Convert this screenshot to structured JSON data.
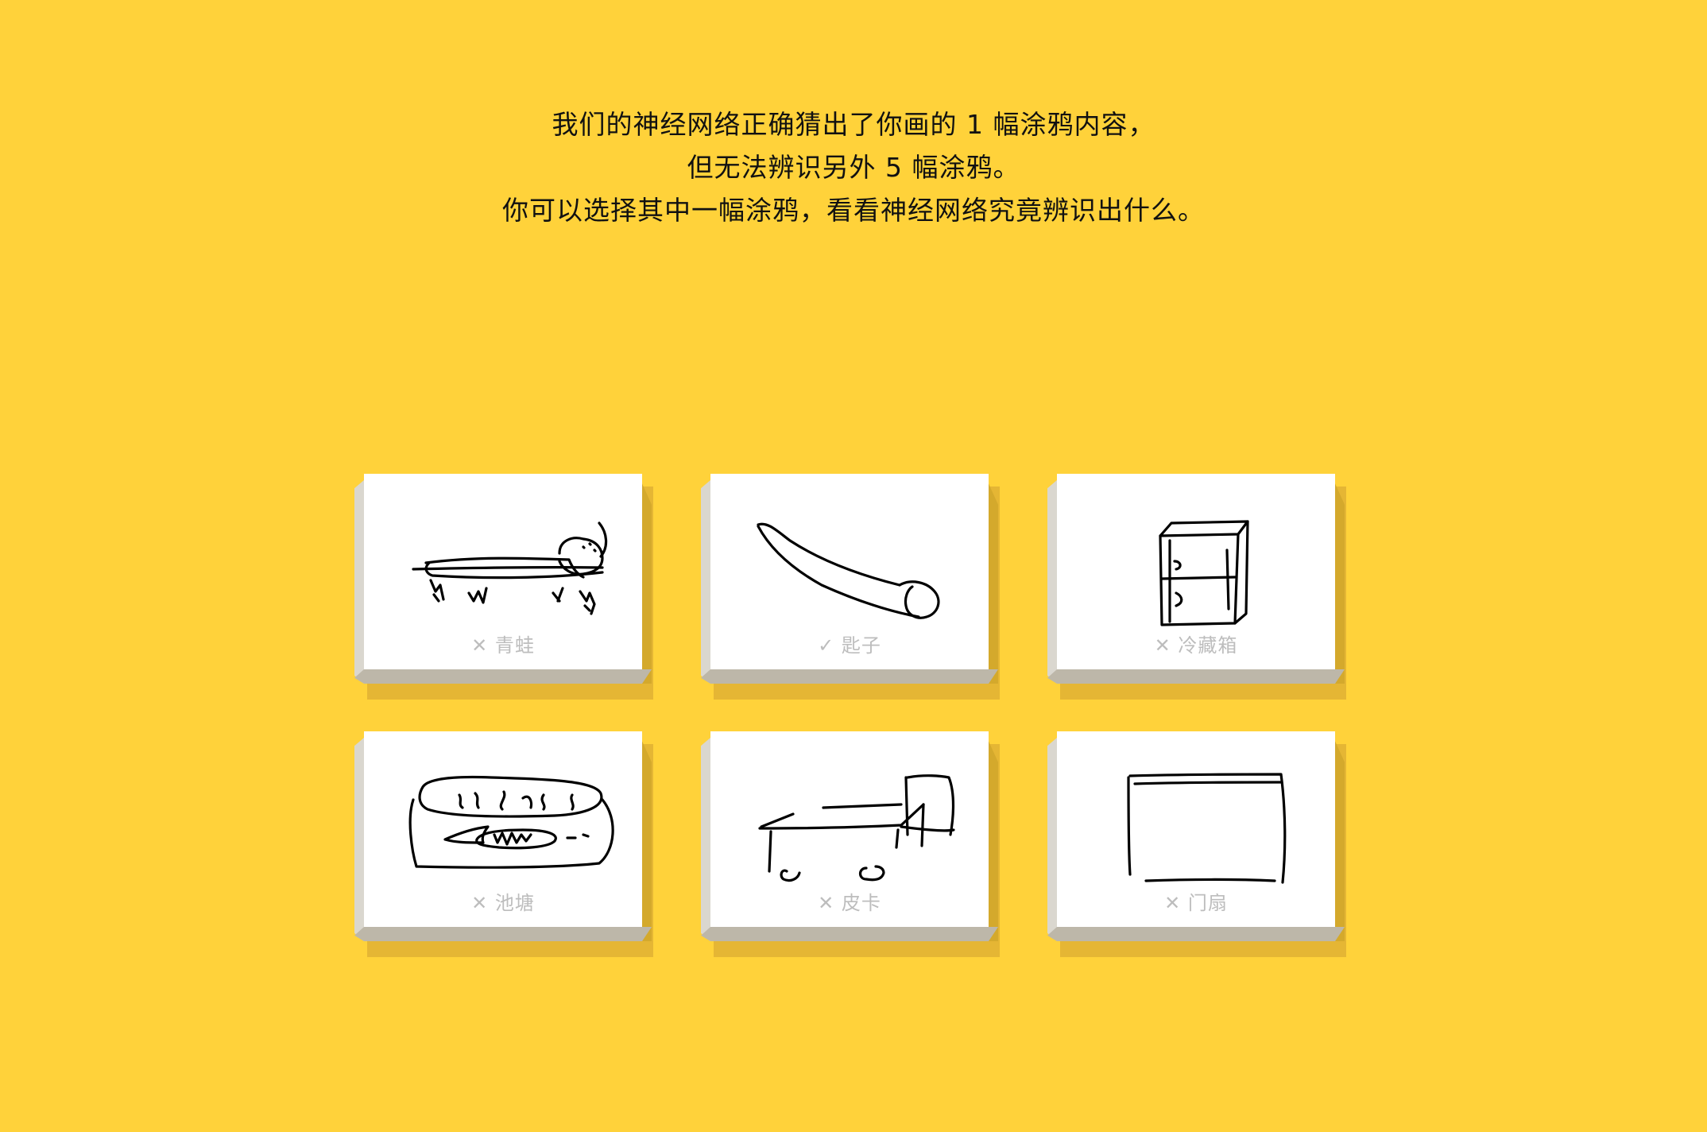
{
  "message": {
    "line1": "我们的神经网络正确猜出了你画的 1 幅涂鸦内容，",
    "line2": "但无法辨识另外 5 幅涂鸦。",
    "line3": "你可以选择其中一幅涂鸦，看看神经网络究竟辨识出什么。"
  },
  "marks": {
    "wrong": "✕",
    "right": "✓"
  },
  "doodles": [
    {
      "label": "青蛙",
      "correct": false,
      "icon": "frog-doodle"
    },
    {
      "label": "匙子",
      "correct": true,
      "icon": "spoon-doodle"
    },
    {
      "label": "冷藏箱",
      "correct": false,
      "icon": "cooler-doodle"
    },
    {
      "label": "池塘",
      "correct": false,
      "icon": "pond-doodle"
    },
    {
      "label": "皮卡",
      "correct": false,
      "icon": "pickup-truck-doodle"
    },
    {
      "label": "门扇",
      "correct": false,
      "icon": "door-doodle"
    }
  ]
}
